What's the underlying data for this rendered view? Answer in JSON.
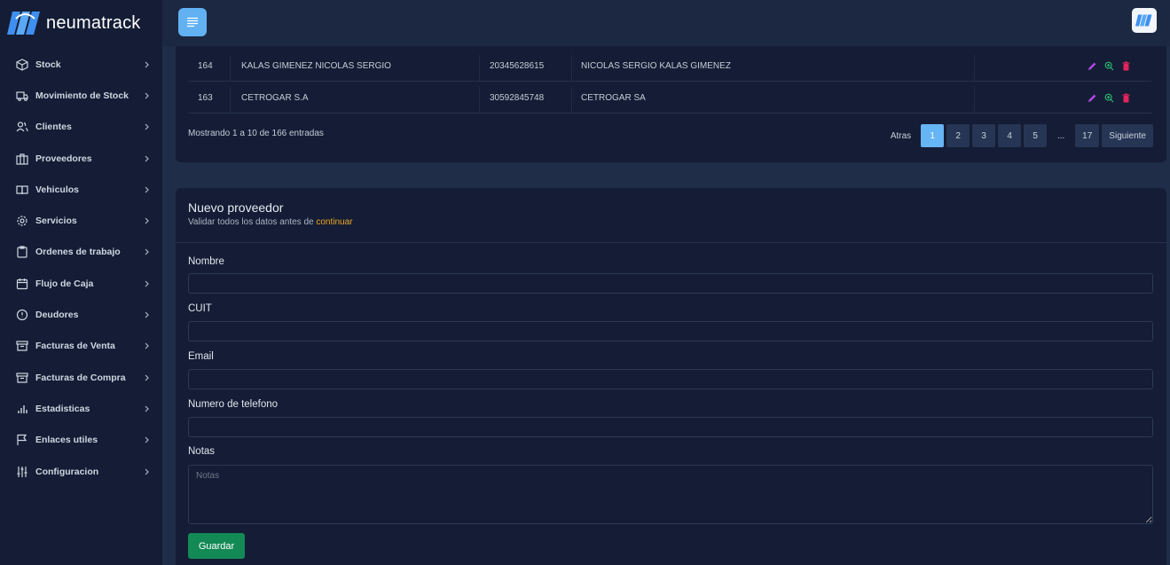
{
  "brand": {
    "name": "neumatrack",
    "logo_icon": "neumatrack-logo-icon"
  },
  "colors": {
    "accent": "#66b5f4",
    "save": "#138a55",
    "highlight": "#f0a623",
    "edit": "#b347e6",
    "view": "#2bb673",
    "delete": "#e0245e"
  },
  "sidebar": {
    "items": [
      {
        "label": "Stock",
        "icon": "box-icon"
      },
      {
        "label": "Movimiento de Stock",
        "icon": "truck-icon"
      },
      {
        "label": "Clientes",
        "icon": "users-icon"
      },
      {
        "label": "Proveedores",
        "icon": "building-icon"
      },
      {
        "label": "Vehiculos",
        "icon": "book-icon"
      },
      {
        "label": "Servicios",
        "icon": "gear-icon"
      },
      {
        "label": "Ordenes de trabajo",
        "icon": "clipboard-icon"
      },
      {
        "label": "Flujo de Caja",
        "icon": "calendar-icon"
      },
      {
        "label": "Deudores",
        "icon": "alert-circle-icon"
      },
      {
        "label": "Facturas de Venta",
        "icon": "archive-icon"
      },
      {
        "label": "Facturas de Compra",
        "icon": "archive-icon"
      },
      {
        "label": "Estadisticas",
        "icon": "bar-chart-icon"
      },
      {
        "label": "Enlaces utiles",
        "icon": "flag-icon"
      },
      {
        "label": "Configuracion",
        "icon": "sliders-icon"
      }
    ]
  },
  "table": {
    "rows": [
      {
        "id": "164",
        "name": "KALAS GIMENEZ NICOLAS SERGIO",
        "cuit": "20345628615",
        "contact": "NICOLAS SERGIO KALAS GIMENEZ"
      },
      {
        "id": "163",
        "name": "CETROGAR S.A",
        "cuit": "30592845748",
        "contact": "CETROGAR SA"
      }
    ],
    "showing": "Mostrando 1 a 10 de 166 entradas",
    "pagination": {
      "prev": "Atras",
      "pages": [
        "1",
        "2",
        "3",
        "4",
        "5"
      ],
      "ellipsis": "...",
      "last": "17",
      "next": "Siguiente",
      "current": "1"
    }
  },
  "form": {
    "title": "Nuevo proveedor",
    "subtitle_prefix": "Validar todos los datos antes de ",
    "subtitle_highlight": "continuar",
    "fields": {
      "nombre": {
        "label": "Nombre",
        "value": ""
      },
      "cuit": {
        "label": "CUIT",
        "value": ""
      },
      "email": {
        "label": "Email",
        "value": ""
      },
      "telefono": {
        "label": "Numero de telefono",
        "value": ""
      },
      "notas": {
        "label": "Notas",
        "placeholder": "Notas",
        "value": ""
      }
    },
    "save_label": "Guardar"
  }
}
